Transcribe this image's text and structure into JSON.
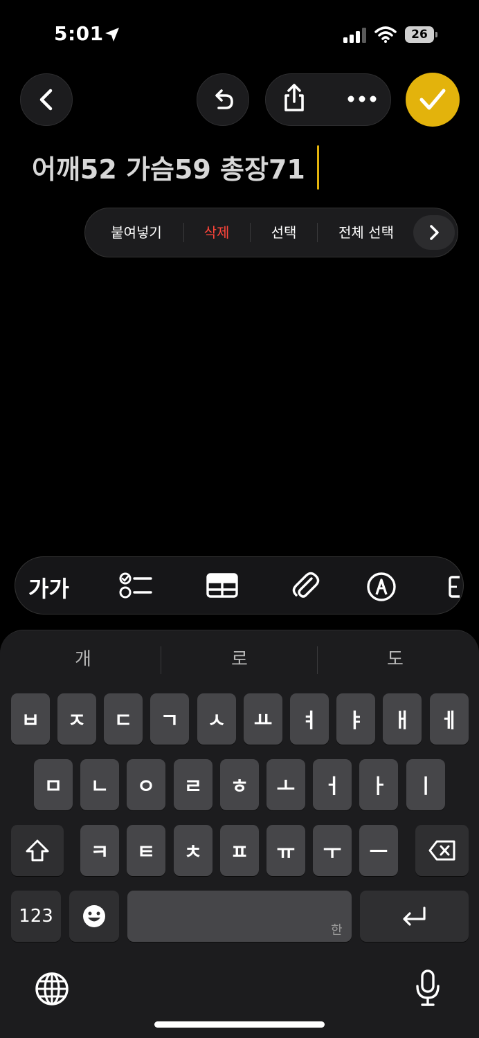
{
  "status": {
    "time": "5:01",
    "battery": "26"
  },
  "note": {
    "text": "어깨52 가슴59 총장71"
  },
  "edit_menu": {
    "paste": "붙여넣기",
    "delete": "삭제",
    "select": "선택",
    "select_all": "전체 선택"
  },
  "format_bar": {
    "text_style": "가가"
  },
  "keyboard": {
    "suggestions": [
      "개",
      "로",
      "도"
    ],
    "row1": [
      "ㅂ",
      "ㅈ",
      "ㄷ",
      "ㄱ",
      "ㅅ",
      "ㅛ",
      "ㅕ",
      "ㅑ",
      "ㅐ",
      "ㅔ"
    ],
    "row2": [
      "ㅁ",
      "ㄴ",
      "ㅇ",
      "ㄹ",
      "ㅎ",
      "ㅗ",
      "ㅓ",
      "ㅏ",
      "ㅣ"
    ],
    "row3": [
      "ㅋ",
      "ㅌ",
      "ㅊ",
      "ㅍ",
      "ㅠ",
      "ㅜ",
      "ㅡ"
    ],
    "numbers": "123",
    "space_hint": "한"
  },
  "colors": {
    "accent": "#e3b30c",
    "delete_text": "#ff453a"
  }
}
